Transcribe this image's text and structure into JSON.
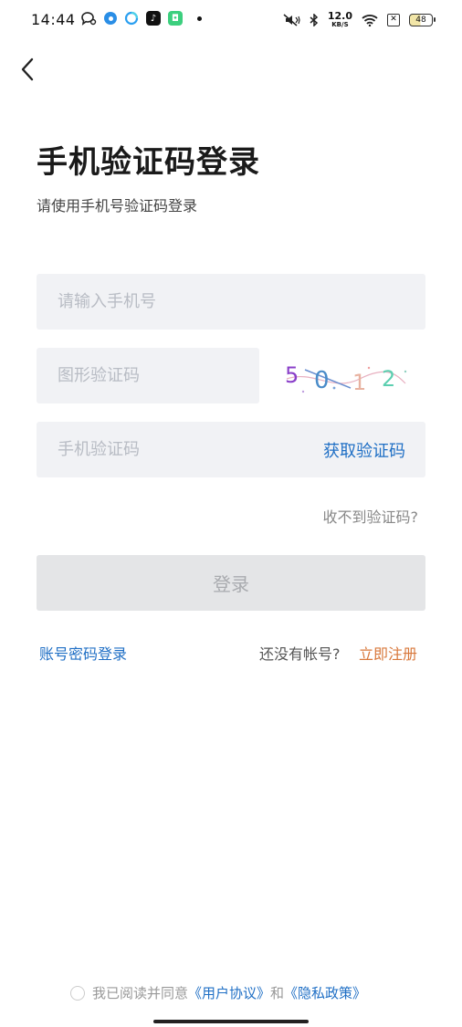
{
  "status_bar": {
    "time": "14:44",
    "net_speed_value": "12.0",
    "net_speed_unit": "KB/S",
    "battery": "48"
  },
  "header": {
    "title": "手机验证码登录",
    "subtitle": "请使用手机号验证码登录"
  },
  "form": {
    "phone_placeholder": "请输入手机号",
    "captcha_placeholder": "图形验证码",
    "captcha_text": "5 0 1 2",
    "code_placeholder": "手机验证码",
    "get_code_label": "获取验证码",
    "no_code_label": "收不到验证码?",
    "login_label": "登录"
  },
  "links": {
    "password_login": "账号密码登录",
    "no_account": "还没有帐号?",
    "register": "立即注册"
  },
  "agreement": {
    "prefix": "我已阅读并同意",
    "user_agreement": "《用户协议》",
    "and": "和",
    "privacy_policy": "《隐私政策》"
  },
  "colors": {
    "link_blue": "#1f6fc5",
    "register_orange": "#d8773a",
    "field_bg": "#f1f2f5",
    "disabled_button": "#e4e5e7"
  }
}
